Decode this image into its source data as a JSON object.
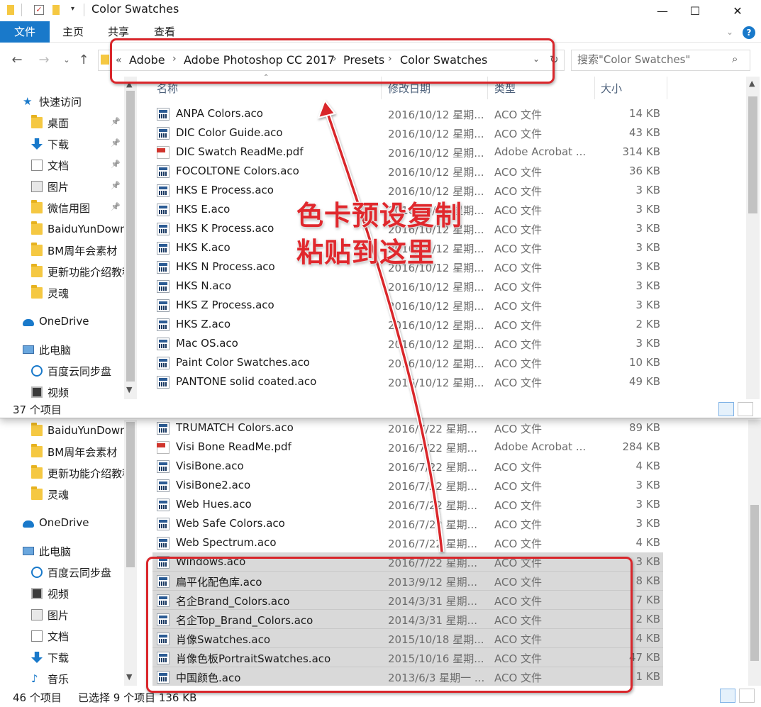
{
  "window": {
    "title": "Color Swatches",
    "ribbon_tabs": [
      "文件",
      "主页",
      "共享",
      "查看"
    ],
    "controls": {
      "minimize": "—",
      "maximize": "☐",
      "close": "✕"
    },
    "help": "?"
  },
  "address": {
    "overflow": "«",
    "crumbs": [
      "Adobe",
      "Adobe Photoshop CC 2017",
      "Presets",
      "Color Swatches"
    ],
    "separator": "›"
  },
  "search": {
    "placeholder": "搜索\"Color Swatches\""
  },
  "columns": {
    "name": "名称",
    "date": "修改日期",
    "type": "类型",
    "size": "大小"
  },
  "fg_sidebar": [
    {
      "label": "快速访问",
      "icon": "star-icon",
      "pinned": false
    },
    {
      "label": "桌面",
      "icon": "folder-icon",
      "pinned": true
    },
    {
      "label": "下载",
      "icon": "download-icon",
      "pinned": true
    },
    {
      "label": "文档",
      "icon": "document-icon",
      "pinned": true
    },
    {
      "label": "图片",
      "icon": "picture-icon",
      "pinned": true
    },
    {
      "label": "微信用图",
      "icon": "folder-icon",
      "pinned": true
    },
    {
      "label": "BaiduYunDown",
      "icon": "folder-icon",
      "pinned": false
    },
    {
      "label": "BM周年会素材",
      "icon": "folder-icon",
      "pinned": false
    },
    {
      "label": "更新功能介绍教程",
      "icon": "folder-icon",
      "pinned": false
    },
    {
      "label": "灵魂",
      "icon": "folder-icon",
      "pinned": false
    },
    {
      "label": "OneDrive",
      "icon": "cloud-icon",
      "pinned": false
    },
    {
      "label": "此电脑",
      "icon": "computer-icon",
      "pinned": false
    },
    {
      "label": "百度云同步盘",
      "icon": "sync-icon",
      "pinned": false
    },
    {
      "label": "视频",
      "icon": "video-icon",
      "pinned": false
    }
  ],
  "fg_files": [
    {
      "name": "ANPA Colors.aco",
      "date": "2016/10/12 星期...",
      "type": "ACO 文件",
      "size": "14 KB",
      "icon": "aco"
    },
    {
      "name": "DIC Color Guide.aco",
      "date": "2016/10/12 星期...",
      "type": "ACO 文件",
      "size": "43 KB",
      "icon": "aco"
    },
    {
      "name": "DIC Swatch ReadMe.pdf",
      "date": "2016/10/12 星期...",
      "type": "Adobe Acrobat ...",
      "size": "314 KB",
      "icon": "pdf"
    },
    {
      "name": "FOCOLTONE Colors.aco",
      "date": "2016/10/12 星期...",
      "type": "ACO 文件",
      "size": "36 KB",
      "icon": "aco"
    },
    {
      "name": "HKS E Process.aco",
      "date": "2016/10/12 星期...",
      "type": "ACO 文件",
      "size": "3 KB",
      "icon": "aco"
    },
    {
      "name": "HKS E.aco",
      "date": "2016/10/12 星期...",
      "type": "ACO 文件",
      "size": "3 KB",
      "icon": "aco"
    },
    {
      "name": "HKS K Process.aco",
      "date": "2016/10/12 星期...",
      "type": "ACO 文件",
      "size": "3 KB",
      "icon": "aco"
    },
    {
      "name": "HKS K.aco",
      "date": "2016/10/12 星期...",
      "type": "ACO 文件",
      "size": "3 KB",
      "icon": "aco"
    },
    {
      "name": "HKS N Process.aco",
      "date": "2016/10/12 星期...",
      "type": "ACO 文件",
      "size": "3 KB",
      "icon": "aco"
    },
    {
      "name": "HKS N.aco",
      "date": "2016/10/12 星期...",
      "type": "ACO 文件",
      "size": "3 KB",
      "icon": "aco"
    },
    {
      "name": "HKS Z Process.aco",
      "date": "2016/10/12 星期...",
      "type": "ACO 文件",
      "size": "3 KB",
      "icon": "aco"
    },
    {
      "name": "HKS Z.aco",
      "date": "2016/10/12 星期...",
      "type": "ACO 文件",
      "size": "2 KB",
      "icon": "aco"
    },
    {
      "name": "Mac OS.aco",
      "date": "2016/10/12 星期...",
      "type": "ACO 文件",
      "size": "3 KB",
      "icon": "aco"
    },
    {
      "name": "Paint Color Swatches.aco",
      "date": "2016/10/12 星期...",
      "type": "ACO 文件",
      "size": "10 KB",
      "icon": "aco"
    },
    {
      "name": "PANTONE solid coated.aco",
      "date": "2016/10/12 星期...",
      "type": "ACO 文件",
      "size": "49 KB",
      "icon": "aco"
    }
  ],
  "fg_status": {
    "count": "37 个项目"
  },
  "bg_sidebar": [
    {
      "label": "BaiduYunDown",
      "icon": "folder-icon"
    },
    {
      "label": "BM周年会素材",
      "icon": "folder-icon"
    },
    {
      "label": "更新功能介绍教程",
      "icon": "folder-icon"
    },
    {
      "label": "灵魂",
      "icon": "folder-icon"
    },
    {
      "label": "OneDrive",
      "icon": "cloud-icon"
    },
    {
      "label": "此电脑",
      "icon": "computer-icon"
    },
    {
      "label": "百度云同步盘",
      "icon": "sync-icon"
    },
    {
      "label": "视频",
      "icon": "video-icon"
    },
    {
      "label": "图片",
      "icon": "picture-icon"
    },
    {
      "label": "文档",
      "icon": "document-icon"
    },
    {
      "label": "下载",
      "icon": "download-icon"
    },
    {
      "label": "音乐",
      "icon": "music-icon"
    }
  ],
  "bg_files": [
    {
      "name": "TRUMATCH Colors.aco",
      "date": "2016/7/22 星期...",
      "type": "ACO 文件",
      "size": "89 KB",
      "icon": "aco",
      "selected": false
    },
    {
      "name": "Visi Bone ReadMe.pdf",
      "date": "2016/7/22 星期...",
      "type": "Adobe Acrobat ...",
      "size": "284 KB",
      "icon": "pdf",
      "selected": false
    },
    {
      "name": "VisiBone.aco",
      "date": "2016/7/22 星期...",
      "type": "ACO 文件",
      "size": "4 KB",
      "icon": "aco",
      "selected": false
    },
    {
      "name": "VisiBone2.aco",
      "date": "2016/7/22 星期...",
      "type": "ACO 文件",
      "size": "3 KB",
      "icon": "aco",
      "selected": false
    },
    {
      "name": "Web Hues.aco",
      "date": "2016/7/22 星期...",
      "type": "ACO 文件",
      "size": "3 KB",
      "icon": "aco",
      "selected": false
    },
    {
      "name": "Web Safe Colors.aco",
      "date": "2016/7/22 星期...",
      "type": "ACO 文件",
      "size": "3 KB",
      "icon": "aco",
      "selected": false
    },
    {
      "name": "Web Spectrum.aco",
      "date": "2016/7/22 星期...",
      "type": "ACO 文件",
      "size": "4 KB",
      "icon": "aco",
      "selected": false
    },
    {
      "name": "Windows.aco",
      "date": "2016/7/22 星期...",
      "type": "ACO 文件",
      "size": "3 KB",
      "icon": "aco",
      "selected": true
    },
    {
      "name": "扁平化配色库.aco",
      "date": "2013/9/12 星期...",
      "type": "ACO 文件",
      "size": "8 KB",
      "icon": "aco",
      "selected": true
    },
    {
      "name": "名企Brand_Colors.aco",
      "date": "2014/3/31 星期...",
      "type": "ACO 文件",
      "size": "7 KB",
      "icon": "aco",
      "selected": true
    },
    {
      "name": "名企Top_Brand_Colors.aco",
      "date": "2014/3/31 星期...",
      "type": "ACO 文件",
      "size": "2 KB",
      "icon": "aco",
      "selected": true
    },
    {
      "name": "肖像Swatches.aco",
      "date": "2015/10/18 星期...",
      "type": "ACO 文件",
      "size": "4 KB",
      "icon": "aco",
      "selected": true
    },
    {
      "name": "肖像色板PortraitSwatches.aco",
      "date": "2015/10/16 星期...",
      "type": "ACO 文件",
      "size": "47 KB",
      "icon": "aco",
      "selected": true
    },
    {
      "name": "中国颜色.aco",
      "date": "2013/6/3 星期一 ...",
      "type": "ACO 文件",
      "size": "1 KB",
      "icon": "aco",
      "selected": true
    }
  ],
  "bg_status": {
    "count": "46 个项目",
    "selected": "已选择 9 个项目 136 KB"
  },
  "annotation": {
    "line1": "色卡预设复制",
    "line2": "粘贴到这里",
    "color": "#e0282d"
  }
}
